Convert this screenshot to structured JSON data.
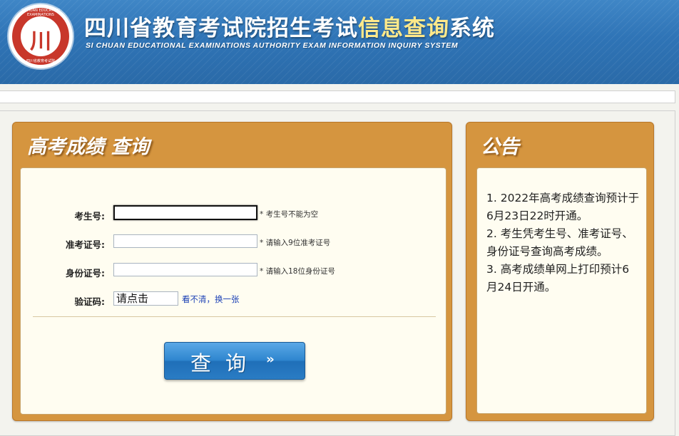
{
  "header": {
    "title_part1": "四川省教育考试院招生考试",
    "title_highlight": "信息查询",
    "title_part2": "系统",
    "subtitle": "SI CHUAN EDUCATIONAL EXAMINATIONS AUTHORITY EXAM INFORMATION INQUIRY SYSTEM",
    "logo_text_top": "SICHUAN EDUCATION EXAMINATIONS",
    "logo_text_bottom": "四川省教育考试院",
    "logo_mark": "川"
  },
  "query_panel": {
    "title": "高考成绩  查询",
    "fields": [
      {
        "label": "考生号:",
        "hint": "* 考生号不能为空",
        "value": ""
      },
      {
        "label": "准考证号:",
        "hint": "* 请输入9位准考证号",
        "value": ""
      },
      {
        "label": "身份证号:",
        "hint": "* 请输入18位身份证号",
        "value": ""
      }
    ],
    "captcha": {
      "label": "验证码:",
      "value": "请点击",
      "refresh": "看不清，换一张"
    },
    "submit_label": "查询",
    "submit_arrows": "››"
  },
  "notice_panel": {
    "title": "公告",
    "items": [
      "1. 2022年高考成绩查询预计于6月23日22时开通。",
      "2. 考生凭考生号、准考证号、身份证号查询高考成绩。",
      "3. 高考成绩单网上打印预计6月24日开通。"
    ]
  },
  "colors": {
    "header_blue": "#2f74b6",
    "panel_orange": "#d5953f",
    "panel_body": "#fffdf1",
    "button_blue": "#2f86cf",
    "title_highlight": "#ffe98a"
  }
}
